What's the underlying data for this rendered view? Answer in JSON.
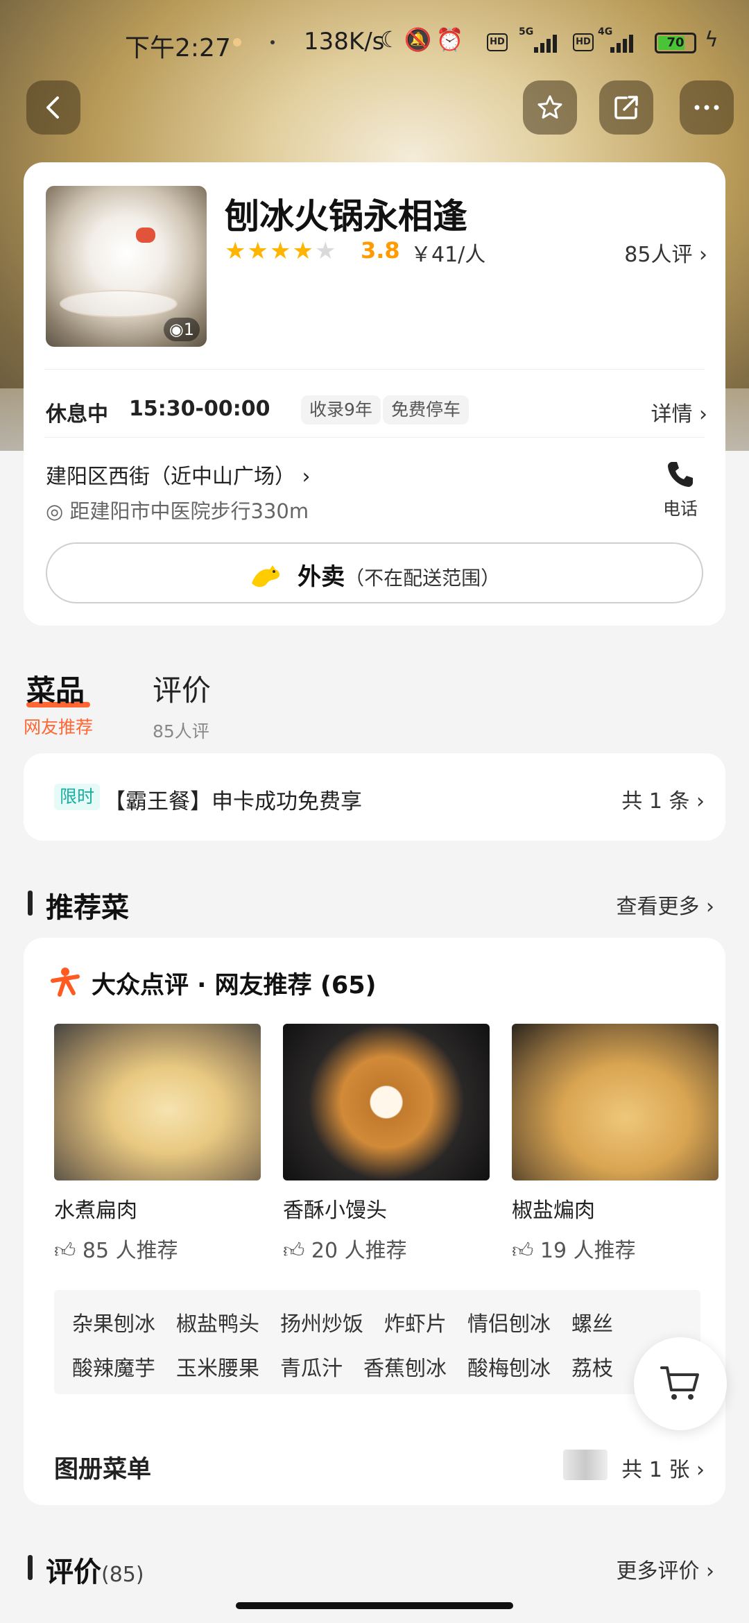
{
  "status_bar": {
    "time": "下午2:27",
    "speed": "138K/s",
    "network_a": "5G",
    "network_b": "4G",
    "battery": "70"
  },
  "shop": {
    "name": "刨冰火锅永相逢",
    "rating_stars": 4,
    "score": "3.8",
    "price": "￥41/人",
    "review_count": "85人评",
    "photo_count": "1",
    "status": "休息中",
    "hours": "15:30-00:00",
    "tags": [
      "收录9年",
      "免费停车"
    ],
    "detail_label": "详情",
    "address": "建阳区西街（近中山广场）",
    "distance": "距建阳市中医院步行330m",
    "phone_label": "电话",
    "takeout_title": "外卖",
    "takeout_note": "（不在配送范围）"
  },
  "tabs": [
    {
      "label": "菜品",
      "sub": "网友推荐",
      "active": true
    },
    {
      "label": "评价",
      "sub": "85人评",
      "active": false
    }
  ],
  "promo": {
    "badge": "限时",
    "text": "【霸王餐】申卡成功免费享",
    "count": "共 1 条"
  },
  "recommended": {
    "title": "推荐菜",
    "more": "查看更多",
    "source_title": "大众点评 · 网友推荐 (65)",
    "dishes": [
      {
        "name": "水煮扁肉",
        "recommend": "85 人推荐"
      },
      {
        "name": "香酥小馒头",
        "recommend": "20 人推荐"
      },
      {
        "name": "椒盐煸肉",
        "recommend": "19 人推荐"
      }
    ],
    "tag_rows": [
      [
        "杂果刨冰",
        "椒盐鸭头",
        "扬州炒饭",
        "炸虾片",
        "情侣刨冰",
        "螺丝"
      ],
      [
        "酸辣魔芋",
        "玉米腰果",
        "青瓜汁",
        "香蕉刨冰",
        "酸梅刨冰",
        "荔枝"
      ]
    ],
    "album_title": "图册菜单",
    "album_count": "共 1 张"
  },
  "reviews": {
    "title": "评价",
    "count": "(85)",
    "more": "更多评价"
  },
  "colors": {
    "accent": "#ff6633",
    "star": "#ffb400",
    "score": "#ff9a00",
    "promo_badge": "#18b0a3"
  }
}
